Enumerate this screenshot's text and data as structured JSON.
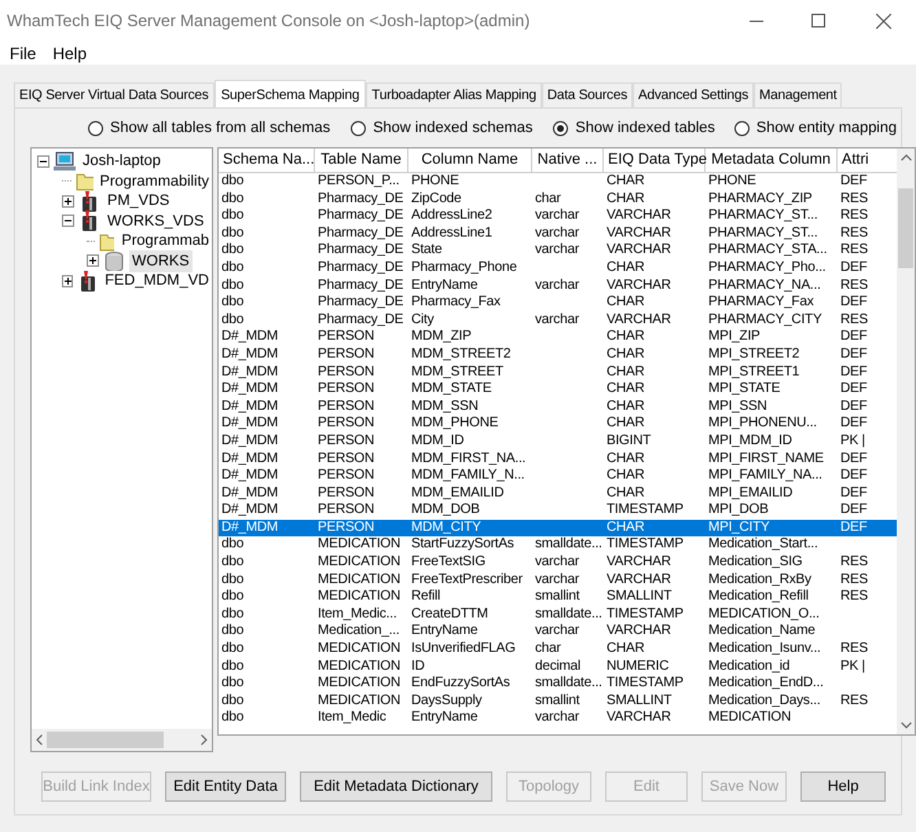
{
  "window": {
    "title": "WhamTech EIQ Server Management Console on <Josh-laptop>(admin)"
  },
  "menu": [
    "File",
    "Help"
  ],
  "tabs": [
    {
      "label": "EIQ Server Virtual Data Sources",
      "selected": false
    },
    {
      "label": "SuperSchema Mapping",
      "selected": true
    },
    {
      "label": "Turboadapter Alias Mapping",
      "selected": false
    },
    {
      "label": "Data Sources",
      "selected": false
    },
    {
      "label": "Advanced Settings",
      "selected": false
    },
    {
      "label": "Management",
      "selected": false
    }
  ],
  "view_options": [
    {
      "label": "Show all tables from all schemas",
      "selected": false
    },
    {
      "label": "Show indexed schemas",
      "selected": false
    },
    {
      "label": "Show indexed tables",
      "selected": true
    },
    {
      "label": "Show entity mapping",
      "selected": false
    }
  ],
  "tree": [
    {
      "label": "Josh-laptop",
      "kind": "computer",
      "expanded": true,
      "selected": false,
      "children": [
        {
          "label": "Programmability",
          "kind": "folder",
          "selected": false
        },
        {
          "label": "PM_VDS",
          "kind": "vds",
          "expanded": false,
          "selected": false
        },
        {
          "label": "WORKS_VDS",
          "kind": "vds",
          "expanded": true,
          "selected": false,
          "children": [
            {
              "label": "Programmab",
              "kind": "folder",
              "selected": false
            },
            {
              "label": "WORKS",
              "kind": "database",
              "expanded": false,
              "selected": true
            }
          ]
        },
        {
          "label": "FED_MDM_VD",
          "kind": "vds",
          "expanded": false,
          "selected": false
        }
      ]
    }
  ],
  "table": {
    "columns": [
      "Schema Na...",
      "Table Name",
      "Column Name",
      "Native ...",
      "EIQ Data Type",
      "Metadata Column",
      "Attri"
    ],
    "rows": [
      {
        "schema": "dbo",
        "table": "PERSON_P...",
        "column": "PHONE",
        "eiq_type": "CHAR",
        "metadata": "PHONE",
        "attribute": "DEF",
        "selected": false
      },
      {
        "schema": "dbo",
        "table": "Pharmacy_DE",
        "column": "ZipCode",
        "native": "char",
        "eiq_type": "CHAR",
        "metadata": "PHARMACY_ZIP",
        "attribute": "RES",
        "selected": false
      },
      {
        "schema": "dbo",
        "table": "Pharmacy_DE",
        "column": "AddressLine2",
        "native": "varchar",
        "eiq_type": "VARCHAR",
        "metadata": "PHARMACY_ST...",
        "attribute": "RES",
        "selected": false
      },
      {
        "schema": "dbo",
        "table": "Pharmacy_DE",
        "column": "AddressLine1",
        "native": "varchar",
        "eiq_type": "VARCHAR",
        "metadata": "PHARMACY_ST...",
        "attribute": "RES",
        "selected": false
      },
      {
        "schema": "dbo",
        "table": "Pharmacy_DE",
        "column": "State",
        "native": "varchar",
        "eiq_type": "VARCHAR",
        "metadata": "PHARMACY_STA...",
        "attribute": "RES",
        "selected": false
      },
      {
        "schema": "dbo",
        "table": "Pharmacy_DE",
        "column": "Pharmacy_Phone",
        "eiq_type": "CHAR",
        "metadata": "PHARMACY_Pho...",
        "attribute": "DEF",
        "selected": false
      },
      {
        "schema": "dbo",
        "table": "Pharmacy_DE",
        "column": "EntryName",
        "native": "varchar",
        "eiq_type": "VARCHAR",
        "metadata": "PHARMACY_NA...",
        "attribute": "RES",
        "selected": false
      },
      {
        "schema": "dbo",
        "table": "Pharmacy_DE",
        "column": "Pharmacy_Fax",
        "eiq_type": "CHAR",
        "metadata": "PHARMACY_Fax",
        "attribute": "DEF",
        "selected": false
      },
      {
        "schema": "dbo",
        "table": "Pharmacy_DE",
        "column": "City",
        "native": "varchar",
        "eiq_type": "VARCHAR",
        "metadata": "PHARMACY_CITY",
        "attribute": "RES",
        "selected": false
      },
      {
        "schema": "D#_MDM",
        "table": "PERSON",
        "column": "MDM_ZIP",
        "eiq_type": "CHAR",
        "metadata": "MPI_ZIP",
        "attribute": "DEF",
        "selected": false
      },
      {
        "schema": "D#_MDM",
        "table": "PERSON",
        "column": "MDM_STREET2",
        "eiq_type": "CHAR",
        "metadata": "MPI_STREET2",
        "attribute": "DEF",
        "selected": false
      },
      {
        "schema": "D#_MDM",
        "table": "PERSON",
        "column": "MDM_STREET",
        "eiq_type": "CHAR",
        "metadata": "MPI_STREET1",
        "attribute": "DEF",
        "selected": false
      },
      {
        "schema": "D#_MDM",
        "table": "PERSON",
        "column": "MDM_STATE",
        "eiq_type": "CHAR",
        "metadata": "MPI_STATE",
        "attribute": "DEF",
        "selected": false
      },
      {
        "schema": "D#_MDM",
        "table": "PERSON",
        "column": "MDM_SSN",
        "eiq_type": "CHAR",
        "metadata": "MPI_SSN",
        "attribute": "DEF",
        "selected": false
      },
      {
        "schema": "D#_MDM",
        "table": "PERSON",
        "column": "MDM_PHONE",
        "eiq_type": "CHAR",
        "metadata": "MPI_PHONENU...",
        "attribute": "DEF",
        "selected": false
      },
      {
        "schema": "D#_MDM",
        "table": "PERSON",
        "column": "MDM_ID",
        "eiq_type": "BIGINT",
        "metadata": "MPI_MDM_ID",
        "attribute": "PK |",
        "selected": false
      },
      {
        "schema": "D#_MDM",
        "table": "PERSON",
        "column": "MDM_FIRST_NA...",
        "eiq_type": "CHAR",
        "metadata": "MPI_FIRST_NAME",
        "attribute": "DEF",
        "selected": false
      },
      {
        "schema": "D#_MDM",
        "table": "PERSON",
        "column": "MDM_FAMILY_N...",
        "eiq_type": "CHAR",
        "metadata": "MPI_FAMILY_NA...",
        "attribute": "DEF",
        "selected": false
      },
      {
        "schema": "D#_MDM",
        "table": "PERSON",
        "column": "MDM_EMAILID",
        "eiq_type": "CHAR",
        "metadata": "MPI_EMAILID",
        "attribute": "DEF",
        "selected": false
      },
      {
        "schema": "D#_MDM",
        "table": "PERSON",
        "column": "MDM_DOB",
        "eiq_type": "TIMESTAMP",
        "metadata": "MPI_DOB",
        "attribute": "DEF",
        "selected": false
      },
      {
        "schema": "D#_MDM",
        "table": "PERSON",
        "column": "MDM_CITY",
        "eiq_type": "CHAR",
        "metadata": "MPI_CITY",
        "attribute": "DEF",
        "selected": true
      },
      {
        "schema": "dbo",
        "table": "MEDICATION",
        "column": "StartFuzzySortAs",
        "native": "smalldate...",
        "eiq_type": "TIMESTAMP",
        "metadata": "Medication_Start...",
        "selected": false
      },
      {
        "schema": "dbo",
        "table": "MEDICATION",
        "column": "FreeTextSIG",
        "native": "varchar",
        "eiq_type": "VARCHAR",
        "metadata": "Medication_SIG",
        "attribute": "RES",
        "selected": false
      },
      {
        "schema": "dbo",
        "table": "MEDICATION",
        "column": "FreeTextPrescriber",
        "native": "varchar",
        "eiq_type": "VARCHAR",
        "metadata": "Medication_RxBy",
        "attribute": "RES",
        "selected": false
      },
      {
        "schema": "dbo",
        "table": "MEDICATION",
        "column": "Refill",
        "native": "smallint",
        "eiq_type": "SMALLINT",
        "metadata": "Medication_Refill",
        "attribute": "RES",
        "selected": false
      },
      {
        "schema": "dbo",
        "table": "Item_Medic...",
        "column": "CreateDTTM",
        "native": "smalldate...",
        "eiq_type": "TIMESTAMP",
        "metadata": "MEDICATION_O...",
        "selected": false
      },
      {
        "schema": "dbo",
        "table": "Medication_...",
        "column": "EntryName",
        "native": "varchar",
        "eiq_type": "VARCHAR",
        "metadata": "Medication_Name",
        "selected": false
      },
      {
        "schema": "dbo",
        "table": "MEDICATION",
        "column": "IsUnverifiedFLAG",
        "native": "char",
        "eiq_type": "CHAR",
        "metadata": "Medication_Isunv...",
        "attribute": "RES",
        "selected": false
      },
      {
        "schema": "dbo",
        "table": "MEDICATION",
        "column": "ID",
        "native": "decimal",
        "eiq_type": "NUMERIC",
        "metadata": "Medication_id",
        "attribute": "PK |",
        "selected": false
      },
      {
        "schema": "dbo",
        "table": "MEDICATION",
        "column": "EndFuzzySortAs",
        "native": "smalldate...",
        "eiq_type": "TIMESTAMP",
        "metadata": "Medication_EndD...",
        "selected": false
      },
      {
        "schema": "dbo",
        "table": "MEDICATION",
        "column": "DaysSupply",
        "native": "smallint",
        "eiq_type": "SMALLINT",
        "metadata": "Medication_Days...",
        "attribute": "RES",
        "selected": false
      },
      {
        "schema": "dbo",
        "table": "Item_Medic",
        "column": "EntryName",
        "native": "varchar",
        "eiq_type": "VARCHAR",
        "metadata": "MEDICATION",
        "selected": false
      }
    ]
  },
  "buttons": [
    {
      "label": "Build Link Index",
      "disabled": true
    },
    {
      "label": "Edit Entity Data",
      "disabled": false
    },
    {
      "label": "Edit Metadata Dictionary",
      "disabled": false
    },
    {
      "label": "Topology",
      "disabled": true
    },
    {
      "label": "Edit",
      "disabled": true
    },
    {
      "label": "Save Now",
      "disabled": true
    },
    {
      "label": "Help",
      "disabled": false
    }
  ]
}
